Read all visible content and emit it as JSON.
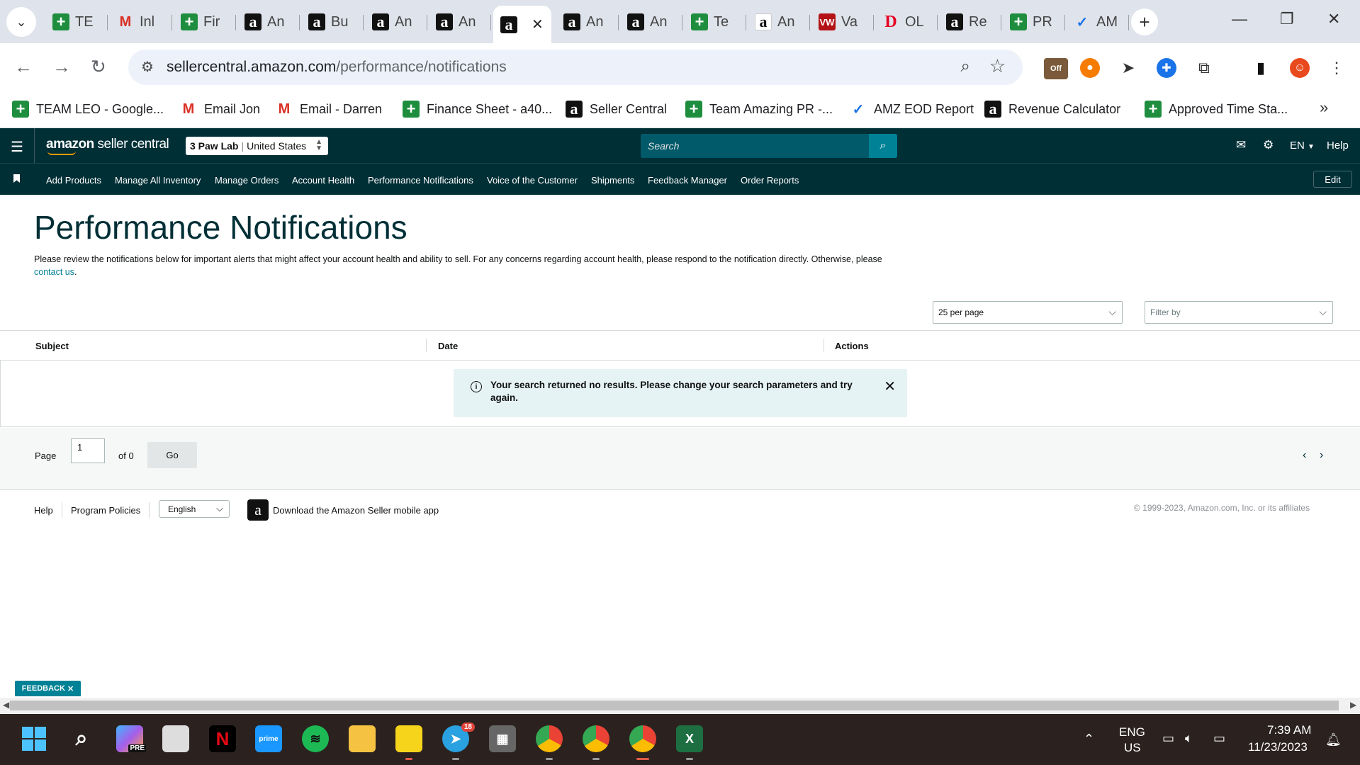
{
  "browser": {
    "tabs": [
      {
        "label": "TE",
        "fav": "sheets",
        "glyph": "+"
      },
      {
        "label": "Inl",
        "fav": "gmail",
        "glyph": "M"
      },
      {
        "label": "Fir",
        "fav": "sheets",
        "glyph": "+"
      },
      {
        "label": "An",
        "fav": "amz",
        "glyph": "a"
      },
      {
        "label": "Bu",
        "fav": "amz",
        "glyph": "a"
      },
      {
        "label": "An",
        "fav": "amz",
        "glyph": "a"
      },
      {
        "label": "An",
        "fav": "amz",
        "glyph": "a"
      },
      {
        "label": "",
        "fav": "amz",
        "glyph": "a",
        "active": true
      },
      {
        "label": "An",
        "fav": "amz",
        "glyph": "a"
      },
      {
        "label": "An",
        "fav": "amz",
        "glyph": "a"
      },
      {
        "label": "Te",
        "fav": "sheets",
        "glyph": "+"
      },
      {
        "label": "An",
        "fav": "amzw",
        "glyph": "a"
      },
      {
        "label": "Va",
        "fav": "vw",
        "glyph": "VW"
      },
      {
        "label": "OL",
        "fav": "pin",
        "glyph": "D"
      },
      {
        "label": "Re",
        "fav": "amz",
        "glyph": "a"
      },
      {
        "label": "PR",
        "fav": "sheets",
        "glyph": "+"
      },
      {
        "label": "AM",
        "fav": "amzp",
        "glyph": "✓"
      }
    ],
    "url_host": "sellercentral.amazon.com",
    "url_path": "/performance/notifications",
    "extension_badge": "Off",
    "bookmarks": [
      {
        "label": "TEAM LEO - Google...",
        "fav": "sheets",
        "glyph": "+"
      },
      {
        "label": "Email Jon",
        "fav": "gmail",
        "glyph": "M"
      },
      {
        "label": "Email - Darren",
        "fav": "gmail",
        "glyph": "M"
      },
      {
        "label": "Finance Sheet - a40...",
        "fav": "sheets",
        "glyph": "+"
      },
      {
        "label": "Seller Central",
        "fav": "amz",
        "glyph": "a"
      },
      {
        "label": "Team Amazing PR -...",
        "fav": "sheets",
        "glyph": "+"
      },
      {
        "label": "AMZ EOD Report",
        "fav": "amzp",
        "glyph": "✓"
      },
      {
        "label": "Revenue Calculator",
        "fav": "amz",
        "glyph": "a"
      },
      {
        "label": "Approved Time Sta...",
        "fav": "sheets",
        "glyph": "+"
      }
    ]
  },
  "header": {
    "logo_bold": "amazon",
    "logo_thin": " seller central",
    "store_name": "3 Paw Lab",
    "store_region": "United States",
    "search_placeholder": "Search",
    "lang": "EN",
    "help": "Help"
  },
  "nav": {
    "items": [
      "Add Products",
      "Manage All Inventory",
      "Manage Orders",
      "Account Health",
      "Performance Notifications",
      "Voice of the Customer",
      "Shipments",
      "Feedback Manager",
      "Order Reports"
    ],
    "edit": "Edit"
  },
  "main": {
    "title": "Performance Notifications",
    "desc_before": "Please review the notifications below for important alerts that might affect your account health and ability to sell. For any concerns regarding account health, please respond to the notification directly. Otherwise, please ",
    "desc_link": "contact us",
    "desc_after": ".",
    "per_page": "25 per page",
    "filter_placeholder": "Filter by",
    "columns": [
      "Subject",
      "Date",
      "Actions"
    ],
    "alert_message": "Your search returned no results. Please change your search parameters and try again.",
    "page_label": "Page",
    "page_value": "1",
    "page_of": "of 0",
    "go": "Go"
  },
  "footer": {
    "help": "Help",
    "policies": "Program Policies",
    "language": "English",
    "download_app": "Download the Amazon Seller mobile app",
    "copyright": "© 1999-2023, Amazon.com, Inc. or its affiliates",
    "feedback": "FEEDBACK"
  },
  "taskbar": {
    "telegram_badge": "18",
    "lang_top": "ENG",
    "lang_bottom": "US",
    "time": "7:39 AM",
    "date": "11/23/2023",
    "pre_badge": "PRE"
  }
}
